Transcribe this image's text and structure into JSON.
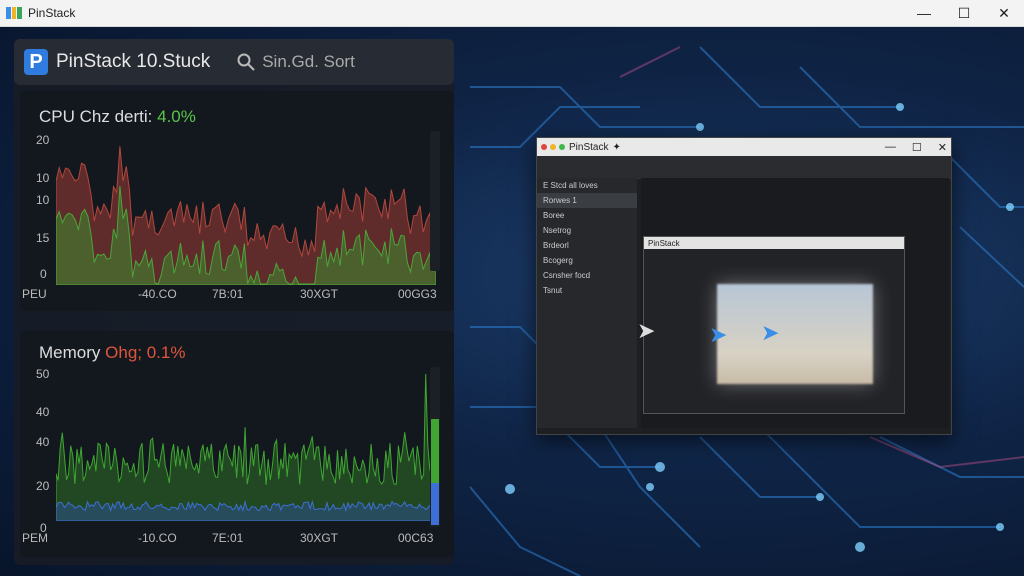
{
  "window": {
    "title": "PinStack",
    "minimize_glyph": "—",
    "maximize_glyph": "☐",
    "close_glyph": "✕"
  },
  "header": {
    "logo_letter": "P",
    "app_name": "PinStack 10.Stuck",
    "search_text": "Sin.Gd. Sort"
  },
  "cpu": {
    "title_prefix": "CPU Chz derti:",
    "title_value": "4.0%",
    "y_ticks": [
      "20",
      "10",
      "10",
      "15",
      "0"
    ],
    "x_ticks": [
      "PEU",
      "-40.CO",
      "7B:01",
      "30XGT",
      "00GG3"
    ],
    "colors": {
      "red": "#b2473c",
      "green": "#4aa63a"
    }
  },
  "memory": {
    "title_prefix": "Memory",
    "title_value": "Ohg; 0.1%",
    "y_ticks": [
      "50",
      "40",
      "40",
      "20",
      "0"
    ],
    "x_ticks": [
      "PEM",
      "-10.CO",
      "7E:01",
      "30XGT",
      "00C63"
    ],
    "colors": {
      "green": "#3fa632",
      "blue": "#3d6fd6"
    }
  },
  "inner_window": {
    "title": "PinStack",
    "sidebar": [
      "E Stcd all loves",
      "Rorwes 1",
      "Boree",
      "Nsetrog",
      "Brdeorl",
      "Bcogerg",
      "Csnsher focd",
      "Tsnut"
    ],
    "inner_title": "PinStack"
  }
}
